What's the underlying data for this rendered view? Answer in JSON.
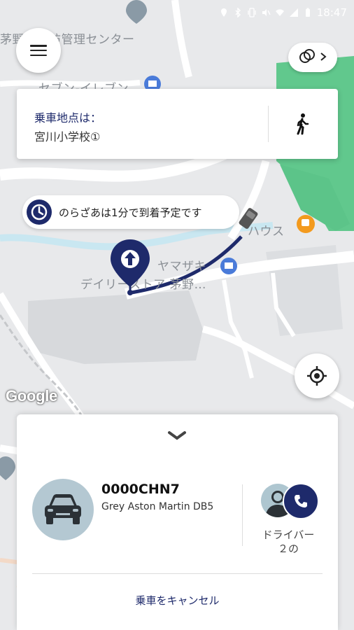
{
  "status_bar": {
    "time": "18:47"
  },
  "map": {
    "labels": [
      "茅野市消防管理センター",
      "セブン-イレブン",
      "ハウス",
      "ヤマザキ",
      "デイリーストア 茅野…"
    ],
    "attribution": "Google"
  },
  "top_buttons": {
    "menu_icon": "hamburger-icon",
    "layers_icon": "layers-icon"
  },
  "pickup": {
    "title": "乗車地点は：",
    "place": "宮川小学校①",
    "walk_icon": "walking-icon"
  },
  "eta": {
    "text": "のらざあは1分で到着予定です",
    "icon": "clock-icon"
  },
  "bottom_sheet": {
    "plate": "0000CHN7",
    "car_model": "Grey Aston Martin DB5",
    "driver_label": "ドライバー２の",
    "cancel_label": "乗車をキャンセル"
  },
  "colors": {
    "navy": "#1e2a6b",
    "park": "#4cc07d",
    "road": "#ffffff",
    "avatar_bg": "#b4c8d2"
  }
}
